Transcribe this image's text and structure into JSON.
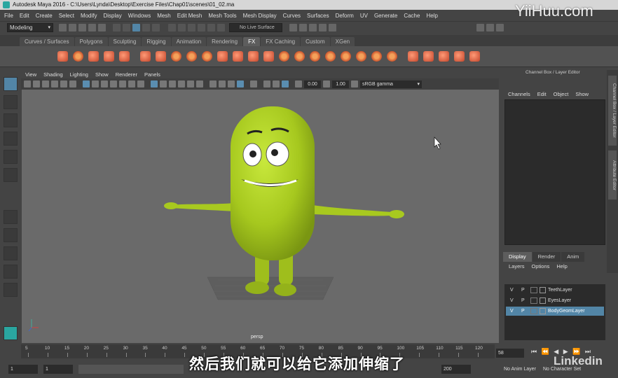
{
  "window": {
    "title": "Autodesk Maya 2016 - C:\\Users\\Lynda\\Desktop\\Exercise Files\\Chap01\\scenes\\01_02.ma"
  },
  "menubar": [
    "File",
    "Edit",
    "Create",
    "Select",
    "Modify",
    "Display",
    "Windows",
    "Mesh",
    "Edit Mesh",
    "Mesh Tools",
    "Mesh Display",
    "Curves",
    "Surfaces",
    "Deform",
    "UV",
    "Generate",
    "Cache",
    "Help"
  ],
  "status_line": {
    "mode": "Modeling",
    "live_surface": "No Live Surface"
  },
  "shelf_tabs": [
    "Curves / Surfaces",
    "Polygons",
    "Sculpting",
    "Rigging",
    "Animation",
    "Rendering",
    "FX",
    "FX Caching",
    "Custom",
    "XGen"
  ],
  "shelf_active": "FX",
  "panel_menu": [
    "View",
    "Shading",
    "Lighting",
    "Show",
    "Renderer",
    "Panels"
  ],
  "panel_toolbar": {
    "value1": "0.00",
    "value2": "1.00",
    "color_space": "sRGB gamma"
  },
  "viewport": {
    "camera": "persp"
  },
  "channel_box": {
    "header": "Channel Box / Layer Editor",
    "menu": [
      "Channels",
      "Edit",
      "Object",
      "Show"
    ]
  },
  "side_tabs": [
    "Channel Box / Layer Editor",
    "Attribute Editor"
  ],
  "layer_editor": {
    "tabs": [
      "Display",
      "Render",
      "Anim"
    ],
    "active_tab": "Display",
    "menu": [
      "Layers",
      "Options",
      "Help"
    ],
    "layers": [
      {
        "v": "V",
        "p": "P",
        "name": "TeethLayer",
        "selected": false
      },
      {
        "v": "V",
        "p": "P",
        "name": "EyesLayer",
        "selected": false
      },
      {
        "v": "V",
        "p": "P",
        "name": "BodyGeomLayer",
        "selected": true
      }
    ]
  },
  "time_slider": {
    "ticks": [
      "5",
      "10",
      "15",
      "20",
      "25",
      "30",
      "35",
      "40",
      "45",
      "50",
      "55",
      "60",
      "65",
      "70",
      "75",
      "80",
      "85",
      "90",
      "95",
      "100",
      "105",
      "110",
      "115",
      "120"
    ],
    "current_frame": "58"
  },
  "range_slider": {
    "start": "1",
    "start2": "1",
    "end": "200",
    "anim_layer": "No Anim Layer",
    "character_set": "No Character Set"
  },
  "overlay": {
    "subtitle": "然后我们就可以给它添加伸缩了",
    "watermark": "YiiHuu.com",
    "brand": "Linkedin"
  }
}
